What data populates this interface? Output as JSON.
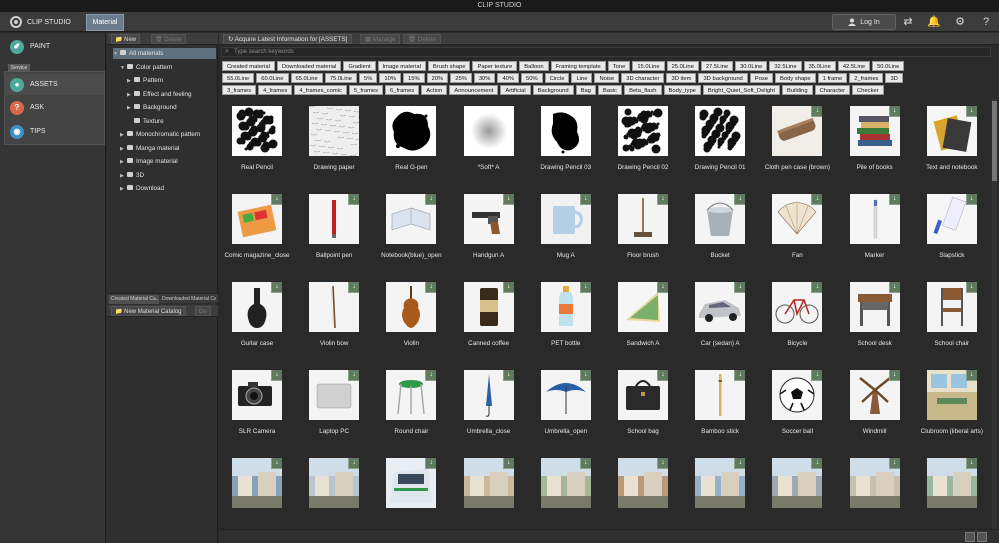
{
  "window": {
    "title": "CLIP STUDIO"
  },
  "topbar": {
    "app_name": "CLIP STUDIO",
    "active_tab": "Material",
    "login_label": "Log In",
    "icons": [
      "switch-icon",
      "bell-icon",
      "gear-icon",
      "help-icon"
    ]
  },
  "leftnav": {
    "service_label": "Service",
    "items": [
      {
        "label": "PAINT",
        "icon": "paint-icon",
        "color": "#4fa99a"
      },
      {
        "label": "ASSETS",
        "icon": "assets-icon",
        "color": "#4fa99a"
      },
      {
        "label": "ASK",
        "icon": "ask-icon",
        "color": "#d9684a"
      },
      {
        "label": "TIPS",
        "icon": "tips-icon",
        "color": "#3c8fc7"
      }
    ]
  },
  "treepanel": {
    "new_label": "New",
    "delete_label": "Delete",
    "items": [
      {
        "label": "All materials",
        "level": 0,
        "arrow": "▼",
        "selected": true
      },
      {
        "label": "Color pattern",
        "level": 1,
        "arrow": "▼"
      },
      {
        "label": "Pattern",
        "level": 2,
        "arrow": "▶"
      },
      {
        "label": "Effect and feeling",
        "level": 2,
        "arrow": "▶"
      },
      {
        "label": "Background",
        "level": 2,
        "arrow": "▶"
      },
      {
        "label": "Texture",
        "level": 2,
        "arrow": ""
      },
      {
        "label": "Monochromatic pattern",
        "level": 1,
        "arrow": "▶"
      },
      {
        "label": "Manga material",
        "level": 1,
        "arrow": "▶"
      },
      {
        "label": "Image material",
        "level": 1,
        "arrow": "▶"
      },
      {
        "label": "3D",
        "level": 1,
        "arrow": "▶"
      },
      {
        "label": "Download",
        "level": 1,
        "arrow": "▶"
      }
    ],
    "tabs": [
      "Created Material Ca...",
      "Downloaded Material Ca..."
    ],
    "catalog_label": "New Material Catalog",
    "catalog_delete": "De"
  },
  "main": {
    "acquire_label": "Acquire Latest Information for [ASSETS]",
    "manage_label": "Manage",
    "delete_label": "Delete",
    "search_placeholder": "Type search keywords",
    "tag_rows": [
      [
        "Created material",
        "Downloaded material",
        "Gradient",
        "Image material",
        "Brush shape",
        "Paper texture",
        "Balloon",
        "Framing template",
        "Tone",
        "15.0Line",
        "25.0Line",
        "27.5Line",
        "30.0Line",
        "32.5Line",
        "35.0Line",
        "42.5Line",
        "50.0Line"
      ],
      [
        "55.0Line",
        "60.0Line",
        "65.0Line",
        "75.0Line",
        "5%",
        "10%",
        "15%",
        "20%",
        "25%",
        "30%",
        "40%",
        "50%",
        "Circle",
        "Line",
        "Noise",
        "3D character",
        "3D item",
        "3D background",
        "Pose",
        "Body shape",
        "1 frame",
        "2_frames",
        "3D"
      ],
      [
        "3_frames",
        "4_frames",
        "4_frames_comic",
        "5_frames",
        "6_frames",
        "Action",
        "Announcement",
        "Artificial",
        "Background",
        "Bag",
        "Basic",
        "Beta_flash",
        "Body_type",
        "Bright_Quiet_Soft_Delight",
        "Building",
        "Character",
        "Checker"
      ]
    ],
    "materials": [
      {
        "label": "Real Pencil",
        "art": "splat",
        "dl": false
      },
      {
        "label": "Drawing paper",
        "art": "paper",
        "dl": false
      },
      {
        "label": "Real G-pen",
        "art": "blob",
        "dl": false
      },
      {
        "label": "*Soft* A",
        "art": "soft",
        "dl": false
      },
      {
        "label": "Drawing Pencil 03",
        "art": "blob2",
        "dl": false
      },
      {
        "label": "Drawing Pencil 02",
        "art": "splat2",
        "dl": false
      },
      {
        "label": "Drawing Pencil 01",
        "art": "splat3",
        "dl": false
      },
      {
        "label": "Cloth pen case (brown)",
        "art": "case",
        "dl": true
      },
      {
        "label": "Pile of books",
        "art": "books",
        "dl": true
      },
      {
        "label": "Text and notebook",
        "art": "notebook",
        "dl": true
      },
      {
        "label": "Comic magazine_close",
        "art": "comic",
        "dl": true
      },
      {
        "label": "Ballpoint pen",
        "art": "pen",
        "dl": true
      },
      {
        "label": "Notebook(blue)_open",
        "art": "openbook",
        "dl": true
      },
      {
        "label": "Handgun A",
        "art": "gun",
        "dl": true
      },
      {
        "label": "Mug A",
        "art": "mug",
        "dl": true
      },
      {
        "label": "Floor brush",
        "art": "broom",
        "dl": true
      },
      {
        "label": "Bucket",
        "art": "bucket",
        "dl": true
      },
      {
        "label": "Fan",
        "art": "fan",
        "dl": true
      },
      {
        "label": "Marker",
        "art": "marker",
        "dl": true
      },
      {
        "label": "Slapstick",
        "art": "slap",
        "dl": true
      },
      {
        "label": "Guitar case",
        "art": "guitarcase",
        "dl": true
      },
      {
        "label": "Violin bow",
        "art": "bow",
        "dl": true
      },
      {
        "label": "Violin",
        "art": "violin",
        "dl": true
      },
      {
        "label": "Canned coffee",
        "art": "can",
        "dl": true
      },
      {
        "label": "PET bottle",
        "art": "bottle",
        "dl": true
      },
      {
        "label": "Sandwich A",
        "art": "sandwich",
        "dl": true
      },
      {
        "label": "Car (sedan) A",
        "art": "car",
        "dl": true
      },
      {
        "label": "Bicycle",
        "art": "bike",
        "dl": true
      },
      {
        "label": "School desk",
        "art": "desk",
        "dl": true
      },
      {
        "label": "School chair",
        "art": "chair",
        "dl": true
      },
      {
        "label": "SLR Camera",
        "art": "camera",
        "dl": true
      },
      {
        "label": "Laptop PC",
        "art": "laptop",
        "dl": true
      },
      {
        "label": "Round chair",
        "art": "stool",
        "dl": true
      },
      {
        "label": "Umbrella_close",
        "art": "umbclose",
        "dl": true
      },
      {
        "label": "Umbrella_open",
        "art": "umbopen",
        "dl": true
      },
      {
        "label": "School bag",
        "art": "bag",
        "dl": true
      },
      {
        "label": "Bamboo stick",
        "art": "stick",
        "dl": true
      },
      {
        "label": "Soccer ball",
        "art": "ball",
        "dl": true
      },
      {
        "label": "Windmill",
        "art": "windmill",
        "dl": true
      },
      {
        "label": "Clubroom (liberal arts)",
        "art": "room",
        "dl": true
      },
      {
        "label": "",
        "art": "scene1",
        "dl": true
      },
      {
        "label": "",
        "art": "scene2",
        "dl": true
      },
      {
        "label": "",
        "art": "train",
        "dl": true
      },
      {
        "label": "",
        "art": "scene3",
        "dl": true
      },
      {
        "label": "",
        "art": "scene4",
        "dl": true
      },
      {
        "label": "",
        "art": "scene5",
        "dl": true
      },
      {
        "label": "",
        "art": "scene6",
        "dl": true
      },
      {
        "label": "",
        "art": "scene7",
        "dl": true
      },
      {
        "label": "",
        "art": "scene8",
        "dl": true
      },
      {
        "label": "",
        "art": "scene9",
        "dl": true
      }
    ]
  }
}
